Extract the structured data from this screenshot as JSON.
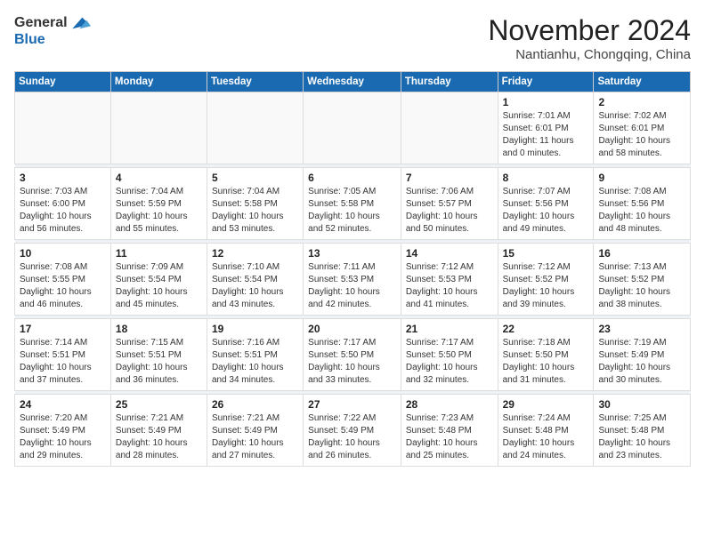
{
  "logo": {
    "general": "General",
    "blue": "Blue"
  },
  "header": {
    "month": "November 2024",
    "location": "Nantianhu, Chongqing, China"
  },
  "weekdays": [
    "Sunday",
    "Monday",
    "Tuesday",
    "Wednesday",
    "Thursday",
    "Friday",
    "Saturday"
  ],
  "weeks": [
    [
      {
        "day": "",
        "info": ""
      },
      {
        "day": "",
        "info": ""
      },
      {
        "day": "",
        "info": ""
      },
      {
        "day": "",
        "info": ""
      },
      {
        "day": "",
        "info": ""
      },
      {
        "day": "1",
        "info": "Sunrise: 7:01 AM\nSunset: 6:01 PM\nDaylight: 11 hours\nand 0 minutes."
      },
      {
        "day": "2",
        "info": "Sunrise: 7:02 AM\nSunset: 6:01 PM\nDaylight: 10 hours\nand 58 minutes."
      }
    ],
    [
      {
        "day": "3",
        "info": "Sunrise: 7:03 AM\nSunset: 6:00 PM\nDaylight: 10 hours\nand 56 minutes."
      },
      {
        "day": "4",
        "info": "Sunrise: 7:04 AM\nSunset: 5:59 PM\nDaylight: 10 hours\nand 55 minutes."
      },
      {
        "day": "5",
        "info": "Sunrise: 7:04 AM\nSunset: 5:58 PM\nDaylight: 10 hours\nand 53 minutes."
      },
      {
        "day": "6",
        "info": "Sunrise: 7:05 AM\nSunset: 5:58 PM\nDaylight: 10 hours\nand 52 minutes."
      },
      {
        "day": "7",
        "info": "Sunrise: 7:06 AM\nSunset: 5:57 PM\nDaylight: 10 hours\nand 50 minutes."
      },
      {
        "day": "8",
        "info": "Sunrise: 7:07 AM\nSunset: 5:56 PM\nDaylight: 10 hours\nand 49 minutes."
      },
      {
        "day": "9",
        "info": "Sunrise: 7:08 AM\nSunset: 5:56 PM\nDaylight: 10 hours\nand 48 minutes."
      }
    ],
    [
      {
        "day": "10",
        "info": "Sunrise: 7:08 AM\nSunset: 5:55 PM\nDaylight: 10 hours\nand 46 minutes."
      },
      {
        "day": "11",
        "info": "Sunrise: 7:09 AM\nSunset: 5:54 PM\nDaylight: 10 hours\nand 45 minutes."
      },
      {
        "day": "12",
        "info": "Sunrise: 7:10 AM\nSunset: 5:54 PM\nDaylight: 10 hours\nand 43 minutes."
      },
      {
        "day": "13",
        "info": "Sunrise: 7:11 AM\nSunset: 5:53 PM\nDaylight: 10 hours\nand 42 minutes."
      },
      {
        "day": "14",
        "info": "Sunrise: 7:12 AM\nSunset: 5:53 PM\nDaylight: 10 hours\nand 41 minutes."
      },
      {
        "day": "15",
        "info": "Sunrise: 7:12 AM\nSunset: 5:52 PM\nDaylight: 10 hours\nand 39 minutes."
      },
      {
        "day": "16",
        "info": "Sunrise: 7:13 AM\nSunset: 5:52 PM\nDaylight: 10 hours\nand 38 minutes."
      }
    ],
    [
      {
        "day": "17",
        "info": "Sunrise: 7:14 AM\nSunset: 5:51 PM\nDaylight: 10 hours\nand 37 minutes."
      },
      {
        "day": "18",
        "info": "Sunrise: 7:15 AM\nSunset: 5:51 PM\nDaylight: 10 hours\nand 36 minutes."
      },
      {
        "day": "19",
        "info": "Sunrise: 7:16 AM\nSunset: 5:51 PM\nDaylight: 10 hours\nand 34 minutes."
      },
      {
        "day": "20",
        "info": "Sunrise: 7:17 AM\nSunset: 5:50 PM\nDaylight: 10 hours\nand 33 minutes."
      },
      {
        "day": "21",
        "info": "Sunrise: 7:17 AM\nSunset: 5:50 PM\nDaylight: 10 hours\nand 32 minutes."
      },
      {
        "day": "22",
        "info": "Sunrise: 7:18 AM\nSunset: 5:50 PM\nDaylight: 10 hours\nand 31 minutes."
      },
      {
        "day": "23",
        "info": "Sunrise: 7:19 AM\nSunset: 5:49 PM\nDaylight: 10 hours\nand 30 minutes."
      }
    ],
    [
      {
        "day": "24",
        "info": "Sunrise: 7:20 AM\nSunset: 5:49 PM\nDaylight: 10 hours\nand 29 minutes."
      },
      {
        "day": "25",
        "info": "Sunrise: 7:21 AM\nSunset: 5:49 PM\nDaylight: 10 hours\nand 28 minutes."
      },
      {
        "day": "26",
        "info": "Sunrise: 7:21 AM\nSunset: 5:49 PM\nDaylight: 10 hours\nand 27 minutes."
      },
      {
        "day": "27",
        "info": "Sunrise: 7:22 AM\nSunset: 5:49 PM\nDaylight: 10 hours\nand 26 minutes."
      },
      {
        "day": "28",
        "info": "Sunrise: 7:23 AM\nSunset: 5:48 PM\nDaylight: 10 hours\nand 25 minutes."
      },
      {
        "day": "29",
        "info": "Sunrise: 7:24 AM\nSunset: 5:48 PM\nDaylight: 10 hours\nand 24 minutes."
      },
      {
        "day": "30",
        "info": "Sunrise: 7:25 AM\nSunset: 5:48 PM\nDaylight: 10 hours\nand 23 minutes."
      }
    ]
  ]
}
